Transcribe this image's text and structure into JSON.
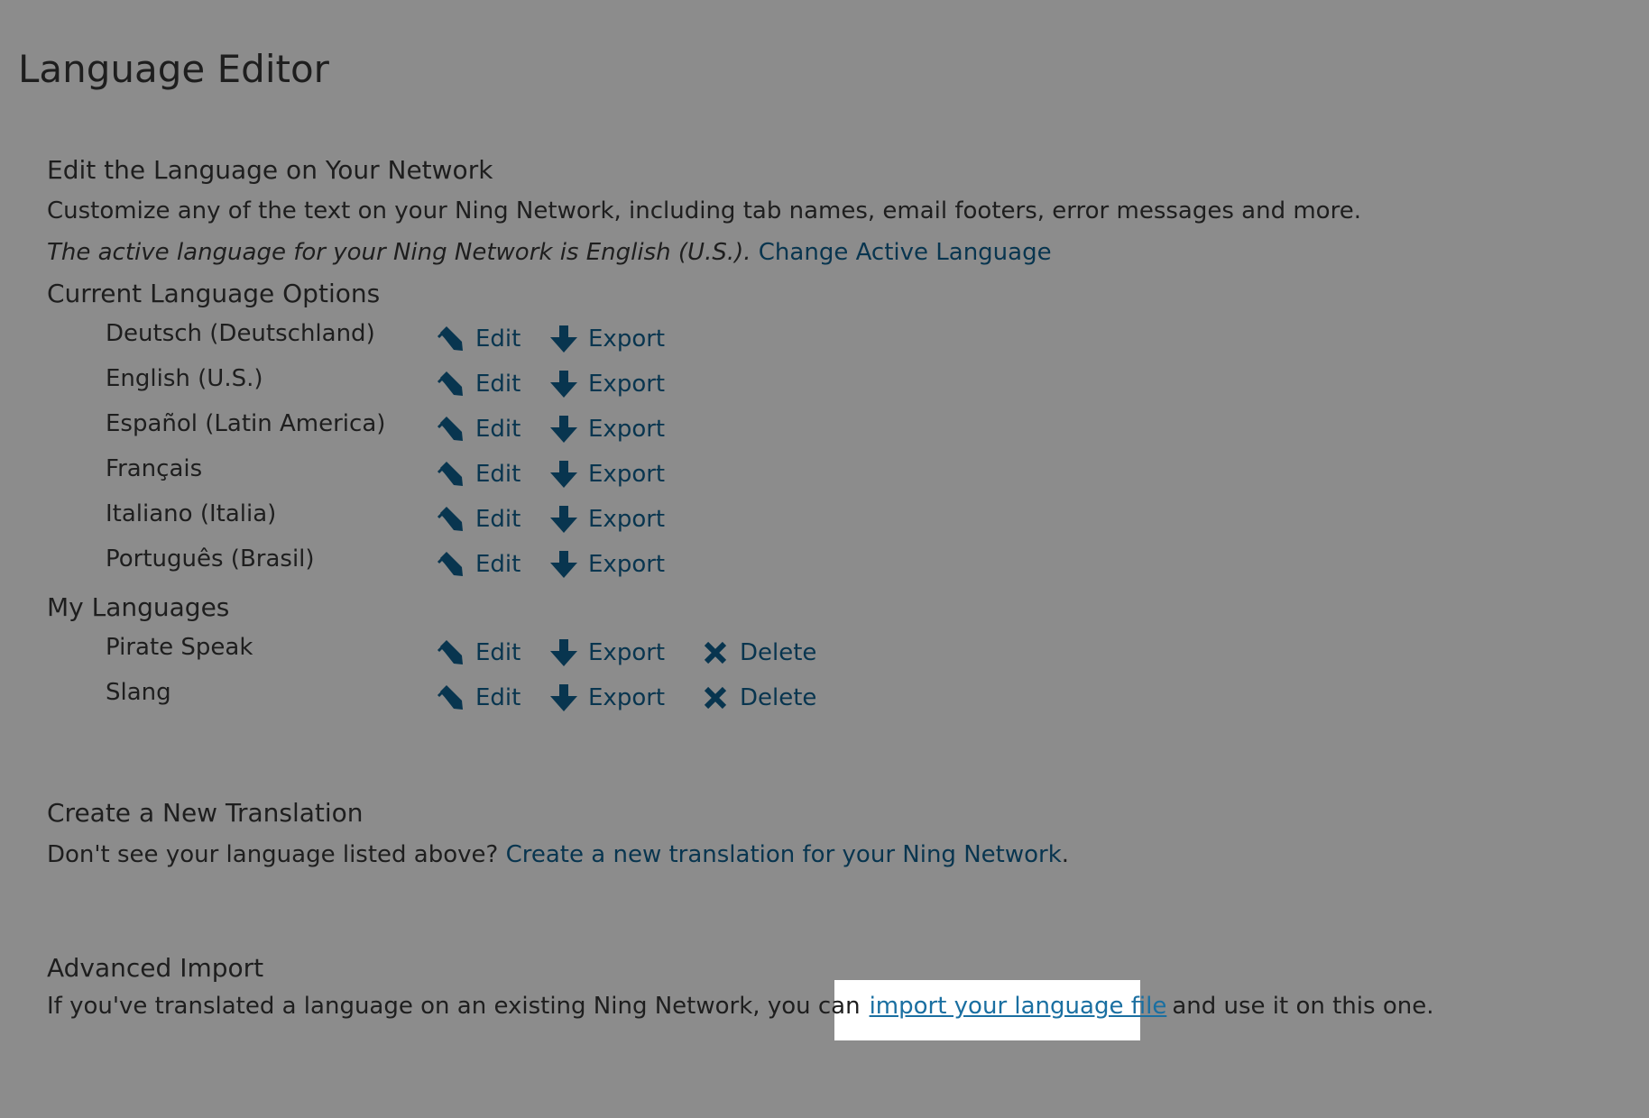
{
  "page": {
    "title": "Language Editor"
  },
  "edit_section": {
    "heading": "Edit the Language on Your Network",
    "description": "Customize any of the text on your Ning Network, including tab names, email footers, error messages and more.",
    "active_language_text": "The active language for your Ning Network is English (U.S.).",
    "change_active_link": "Change Active Language"
  },
  "current_languages": {
    "heading": "Current Language Options",
    "items": [
      {
        "name": "Deutsch (Deutschland)",
        "edit": "Edit",
        "export": "Export"
      },
      {
        "name": "English (U.S.)",
        "edit": "Edit",
        "export": "Export"
      },
      {
        "name": "Español (Latin America)",
        "edit": "Edit",
        "export": "Export"
      },
      {
        "name": "Français",
        "edit": "Edit",
        "export": "Export"
      },
      {
        "name": "Italiano (Italia)",
        "edit": "Edit",
        "export": "Export"
      },
      {
        "name": "Português (Brasil)",
        "edit": "Edit",
        "export": "Export"
      }
    ]
  },
  "my_languages": {
    "heading": "My Languages",
    "items": [
      {
        "name": "Pirate Speak",
        "edit": "Edit",
        "export": "Export",
        "delete": "Delete"
      },
      {
        "name": "Slang",
        "edit": "Edit",
        "export": "Export",
        "delete": "Delete"
      }
    ]
  },
  "create_section": {
    "heading": "Create a New Translation",
    "text_before": "Don't see your language listed above?",
    "link": "Create a new translation for your Ning Network",
    "text_after": "."
  },
  "import_section": {
    "heading": "Advanced Import",
    "text_before": "If you've translated a language on an existing Ning Network, you can",
    "link": "import your language file",
    "text_after": "and use it on this one."
  },
  "icons": {
    "edit": "pencil-icon",
    "export": "download-arrow-icon",
    "delete": "close-x-icon"
  },
  "colors": {
    "background": "#8c8c8c",
    "text": "#1e1e1e",
    "link": "#08354f",
    "highlight_link": "#1a6fa1",
    "highlight_bg": "#ffffff"
  }
}
